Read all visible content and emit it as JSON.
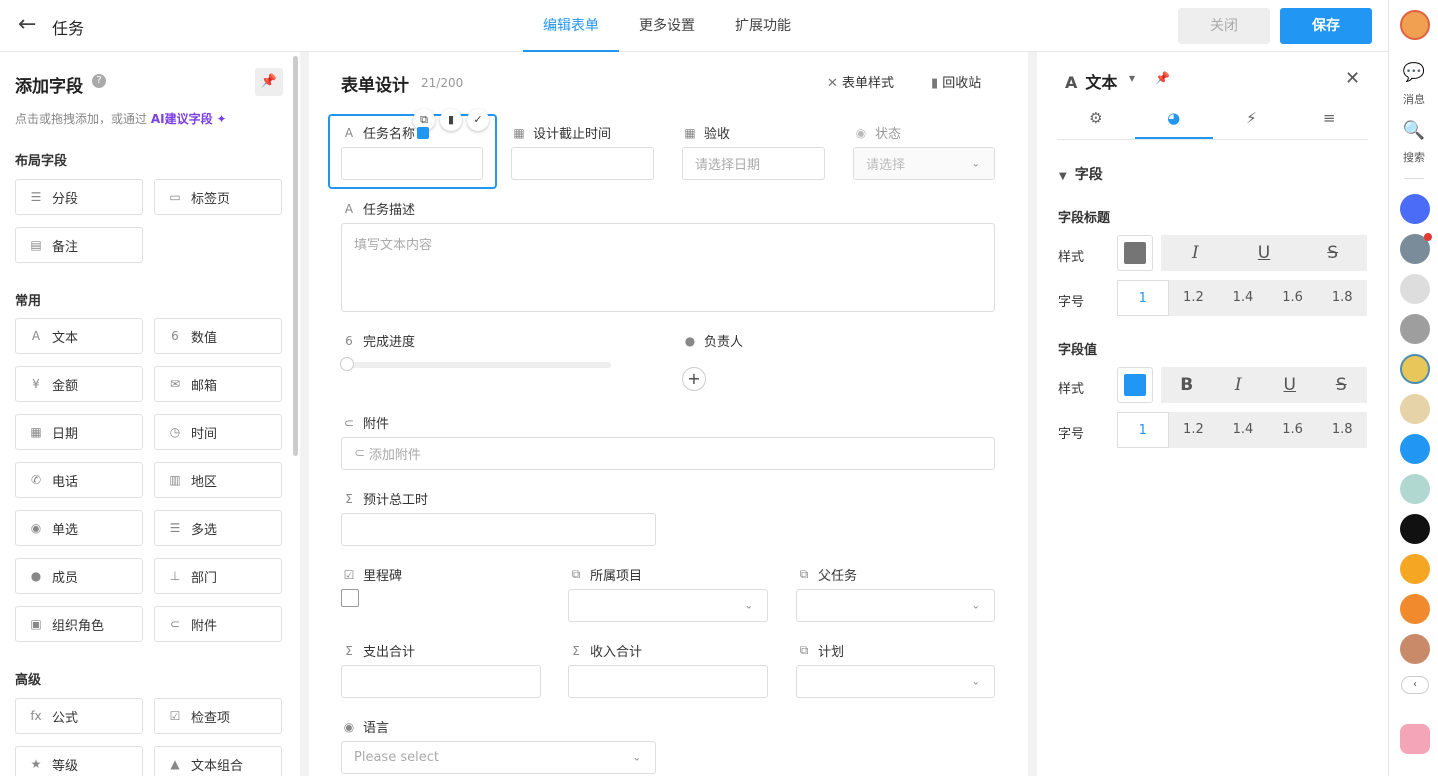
{
  "header": {
    "title": "任务",
    "tabs": [
      "编辑表单",
      "更多设置",
      "扩展功能"
    ],
    "close_label": "关闭",
    "save_label": "保存"
  },
  "left_panel": {
    "title": "添加字段",
    "hint_prefix": "点击或拖拽添加，或通过",
    "ai_link": "AI建议字段",
    "sections": {
      "layout": "布局字段",
      "common": "常用",
      "advanced": "高级"
    },
    "layout_fields": [
      "分段",
      "标签页",
      "备注"
    ],
    "common_fields": [
      "文本",
      "数值",
      "金额",
      "邮箱",
      "日期",
      "时间",
      "电话",
      "地区",
      "单选",
      "多选",
      "成员",
      "部门",
      "组织角色",
      "附件"
    ],
    "advanced_fields": [
      "公式",
      "检查项",
      "等级",
      "文本组合"
    ]
  },
  "form": {
    "title": "表单设计",
    "count": "21/200",
    "style_label": "表单样式",
    "recycle_label": "回收站",
    "fields": {
      "task_name": "任务名称",
      "design_deadline": "设计截止时间",
      "acceptance": "验收",
      "acceptance_placeholder": "请选择日期",
      "status": "状态",
      "status_placeholder": "请选择",
      "description": "任务描述",
      "description_placeholder": "填写文本内容",
      "progress": "完成进度",
      "owner": "负责人",
      "attachment": "附件",
      "attachment_placeholder": "添加附件",
      "estimated_hours": "预计总工时",
      "milestone": "里程碑",
      "project": "所属项目",
      "parent_task": "父任务",
      "expense_total": "支出合计",
      "income_total": "收入合计",
      "plan": "计划",
      "language": "语言",
      "language_placeholder": "Please select"
    }
  },
  "props": {
    "field_type": "文本",
    "section": "字段",
    "title_group": "字段标题",
    "value_group": "字段值",
    "style_label": "样式",
    "size_label": "字号",
    "title_color": "#757575",
    "value_color": "#2196f3",
    "sizes": [
      "1",
      "1.2",
      "1.4",
      "1.6",
      "1.8"
    ]
  },
  "dock": {
    "messages": "消息",
    "search": "搜索"
  },
  "colors": {
    "accent": "#2196f3",
    "ai": "#7b3fe4"
  }
}
